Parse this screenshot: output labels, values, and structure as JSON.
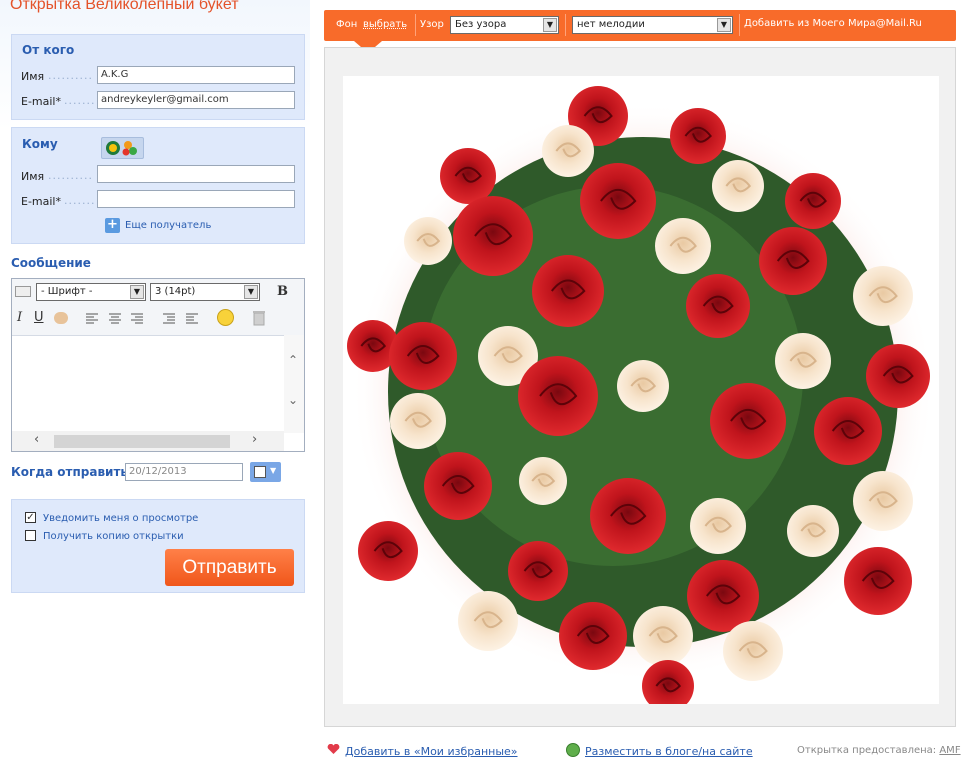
{
  "page": {
    "title": "Открытка Великолепный букет"
  },
  "from": {
    "title": "От кого",
    "name_label": "Имя",
    "name_value": "A.K.G",
    "email_label": "E-mail*",
    "email_value": "andreykeyler@gmail.com"
  },
  "to": {
    "title": "Кому",
    "name_label": "Имя",
    "name_value": "",
    "email_label": "E-mail*",
    "email_value": "",
    "add_recipient": "Еще получатель"
  },
  "message": {
    "title": "Сообщение",
    "font_select": "- Шрифт -",
    "size_select": "3 (14pt)",
    "bold": "B",
    "italic": "I",
    "underline": "U",
    "text": ""
  },
  "send": {
    "when_label": "Когда отправить",
    "date_value": "20/12/2013",
    "notify_label": "Уведомить меня о просмотре",
    "notify_checked": true,
    "copy_label": "Получить копию открытки",
    "copy_checked": false,
    "submit": "Отправить"
  },
  "toolbar": {
    "bg_label": "Фон",
    "bg_link": "выбрать",
    "pattern_label": "Узор",
    "pattern_value": "Без узора",
    "melody_value": "нет мелодии",
    "add_link": "Добавить из Моего Мира@Mail.Ru"
  },
  "footer": {
    "favorites_link": "Добавить в «Мои избранные»",
    "blog_link": "Разместить в блоге/на сайте",
    "credit_label": "Открытка предоставлена:",
    "credit_link": "AMF"
  },
  "colors": {
    "accent": "#f86b2a",
    "panel": "#dfe9fb",
    "link": "#2a5db0",
    "rose_red": "#c0141c",
    "rose_cream": "#f6e2c8",
    "leaf": "#2f5a2a"
  },
  "icons": [
    "mail-agent-icon",
    "contacts-icon",
    "plus-icon",
    "calendar-icon",
    "smiley-icon",
    "trash-icon",
    "heart-icon",
    "globe-icon",
    "scroll-up-icon",
    "scroll-down-icon",
    "scroll-left-icon",
    "scroll-right-icon"
  ]
}
